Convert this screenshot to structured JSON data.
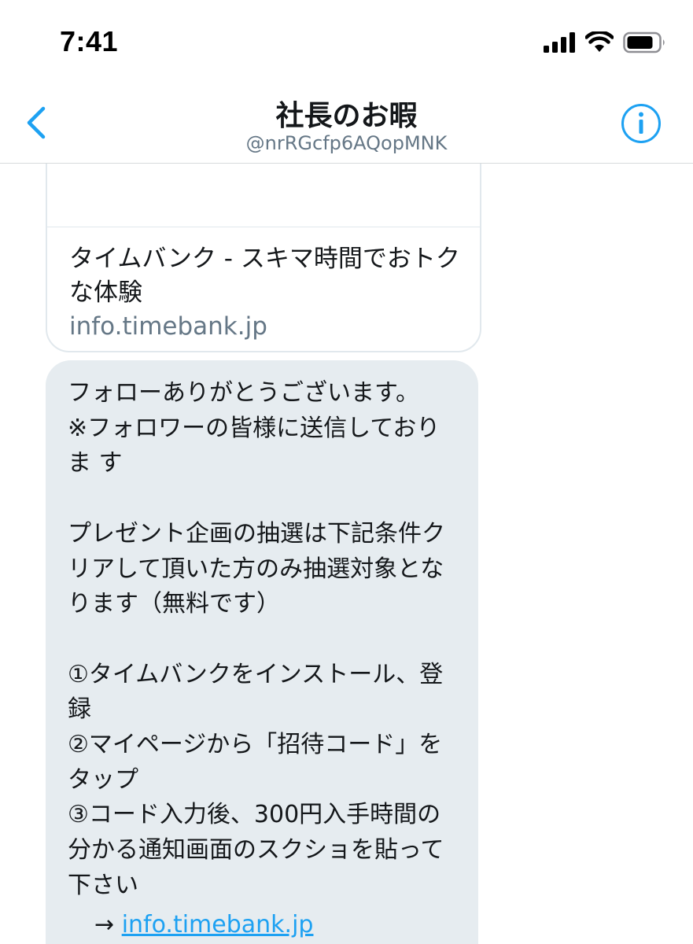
{
  "status_bar": {
    "time": "7:41",
    "icons": [
      "signal-icon",
      "wifi-icon",
      "battery-icon"
    ]
  },
  "header": {
    "title": "社長のお暇",
    "handle": "@nrRGcfp6AQopMNK",
    "back_icon": "chevron-left-icon",
    "info_icon": "info-icon"
  },
  "link_card": {
    "title": "タイムバンク - スキマ時間でおトクな体験",
    "domain": "info.timebank.jp"
  },
  "message": {
    "body": "フォローありがとうございます。\n※フォロワーの皆様に送信しておりま す\n\nプレゼント企画の抽選は下記条件クリアして頂いた方のみ抽選対象となります（無料です）\n\n①タイムバンクをインストール、登録\n②マイページから「招待コード」をタップ\n③コード入力後、300円入手時間の分かる通知画面のスクショを貼って下さい",
    "link_prefix": "→ ",
    "link_text": "info.timebank.jp"
  },
  "colors": {
    "accent": "#1da1f2",
    "bubble_bg": "#e6ecf0",
    "secondary_text": "#657786",
    "divider": "#d7dadd"
  }
}
